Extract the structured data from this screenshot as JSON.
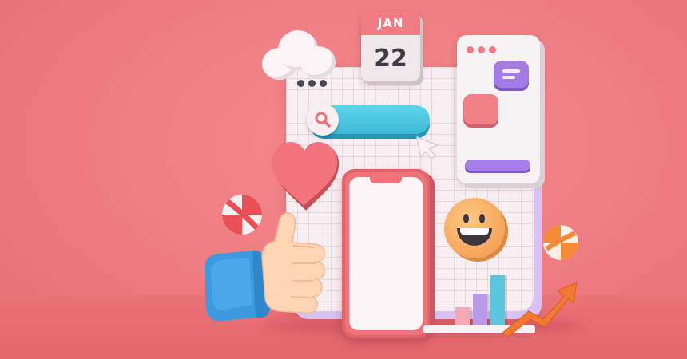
{
  "scene": {
    "description_tags": [
      "social-media-3d-illustration"
    ],
    "background_color": "#ee7b80"
  },
  "calendar": {
    "month": "JAN",
    "day": "22",
    "header_color": "#f17b82"
  },
  "browser_board": {
    "window_dots": 3,
    "search_bar_color": "#4cc6e0"
  },
  "chat_card": {
    "window_dots": 3,
    "dot_color": "#ef7b80",
    "accent_purple": "#a47be4",
    "accent_pink": "#f27f86"
  },
  "icons": {
    "search": "search-icon",
    "cursor": "cursor-arrow-icon",
    "heart": "heart-icon",
    "smiley": "smiley-face-icon",
    "thumbs_up": "thumbs-up-hand-icon",
    "cloud": "cloud-icon",
    "growth_arrow": "growth-arrow-icon"
  },
  "bar_chart": {
    "bars": [
      {
        "value": 0.35,
        "color": "#f3a8b4"
      },
      {
        "value": 0.6,
        "color": "#b99ae8"
      },
      {
        "value": 0.95,
        "color": "#58c6df"
      }
    ],
    "arrow_color": "#f5782f"
  }
}
